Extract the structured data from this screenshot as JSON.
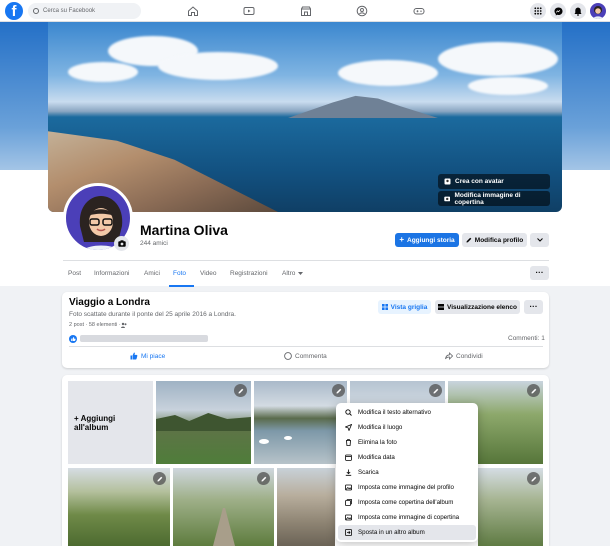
{
  "topbar": {
    "search_placeholder": "Cerca su Facebook",
    "logo": "f"
  },
  "cover": {
    "create_avatar_label": "Crea con avatar",
    "edit_cover_label": "Modifica immagine di copertina"
  },
  "profile": {
    "name": "Martina Oliva",
    "friends": "244 amici",
    "add_story_label": "Aggiungi storia",
    "edit_profile_label": "Modifica profilo"
  },
  "tabs": [
    {
      "label": "Post"
    },
    {
      "label": "Informazioni"
    },
    {
      "label": "Amici"
    },
    {
      "label": "Foto"
    },
    {
      "label": "Video"
    },
    {
      "label": "Registrazioni"
    },
    {
      "label": "Altro"
    }
  ],
  "album": {
    "title": "Viaggio a Londra",
    "description": "Foto scattate durante il ponte del 25 aprile 2016 a Londra.",
    "meta": "2 post · 58 elementi · ",
    "grid_view_label": "Vista griglia",
    "list_view_label": "Visualizzazione elenco",
    "comments_count": "Commenti: 1",
    "like_label": "Mi piace",
    "comment_label": "Commenta",
    "share_label": "Condividi"
  },
  "add_to_album": {
    "line1": "+ Aggiungi",
    "line2": "all'album"
  },
  "context_menu": [
    {
      "label": "Modifica il testo alternativo",
      "icon": "search-icon"
    },
    {
      "label": "Modifica il luogo",
      "icon": "location-arrow-icon"
    },
    {
      "label": "Elimina la foto",
      "icon": "trash-icon"
    },
    {
      "label": "Modifica data",
      "icon": "calendar-icon"
    },
    {
      "label": "Scarica",
      "icon": "download-icon"
    },
    {
      "label": "Imposta come immagine del profilo",
      "icon": "image-icon"
    },
    {
      "label": "Imposta come copertina dell'album",
      "icon": "album-icon"
    },
    {
      "label": "Imposta come immagine di copertina",
      "icon": "image-icon"
    },
    {
      "label": "Sposta in un altro album",
      "icon": "move-album-icon"
    }
  ],
  "colors": {
    "brand": "#1877f2",
    "button_blue": "#1b74e4",
    "background": "#f0f2f5"
  }
}
